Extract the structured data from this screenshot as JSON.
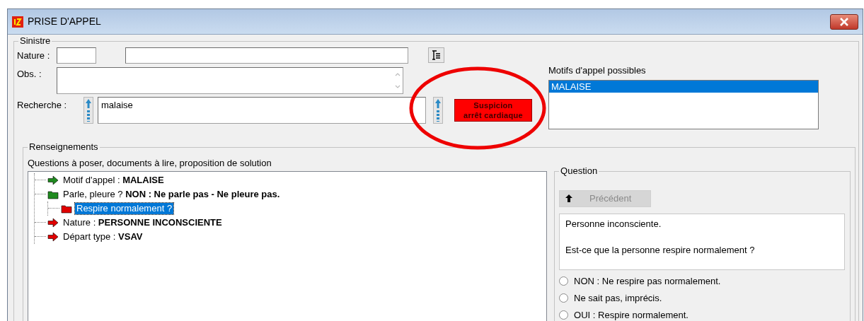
{
  "window": {
    "title": "PRISE D'APPEL"
  },
  "sinistre": {
    "legend": "Sinistre",
    "nature_label": "Nature :",
    "obs_label": "Obs. :",
    "recherche_label": "Recherche :",
    "recherche_value": "malaise",
    "alert_button": [
      "Suspicion",
      "arrêt cardiaque"
    ]
  },
  "motifs": {
    "label": "Motifs d'appel possibles",
    "items": [
      {
        "text": "MALAISE",
        "selected": true
      }
    ]
  },
  "renseignements": {
    "legend": "Renseignements",
    "caption": "Questions à poser, documents à lire, proposition de solution",
    "tree": [
      {
        "kind": "arrow",
        "color": "#1f8a1f",
        "text": "Motif d'appel : **MALAISE**",
        "selected": false
      },
      {
        "kind": "folder",
        "color": "#1f8a1f",
        "text": "Parle, pleure ? **NON : Ne parle pas - Ne pleure pas.**",
        "selected": false,
        "children": [
          {
            "kind": "folder",
            "color": "#e00000",
            "text": "Respire normalement ?",
            "selected": true
          }
        ]
      },
      {
        "kind": "arrow",
        "color": "#e00000",
        "text": "Nature : **PERSONNE INCONSCIENTE**",
        "selected": false
      },
      {
        "kind": "arrow",
        "color": "#e00000",
        "text": "Départ type : **VSAV**",
        "selected": false
      }
    ]
  },
  "question": {
    "legend": "Question",
    "previous_button": {
      "label": "Précédent",
      "disabled": true
    },
    "paragraphs": [
      "Personne inconsciente.",
      "Est-ce que la personne respire normalement ?"
    ],
    "options": [
      {
        "text": "NON : Ne respire pas normalement.",
        "selected": false
      },
      {
        "text": "Ne sait pas, imprécis.",
        "selected": false
      },
      {
        "text": "OUI : Respire normalement.",
        "selected": false
      }
    ]
  },
  "annotations": [
    {
      "kind": "ellipse",
      "color": "#ee0000"
    }
  ]
}
